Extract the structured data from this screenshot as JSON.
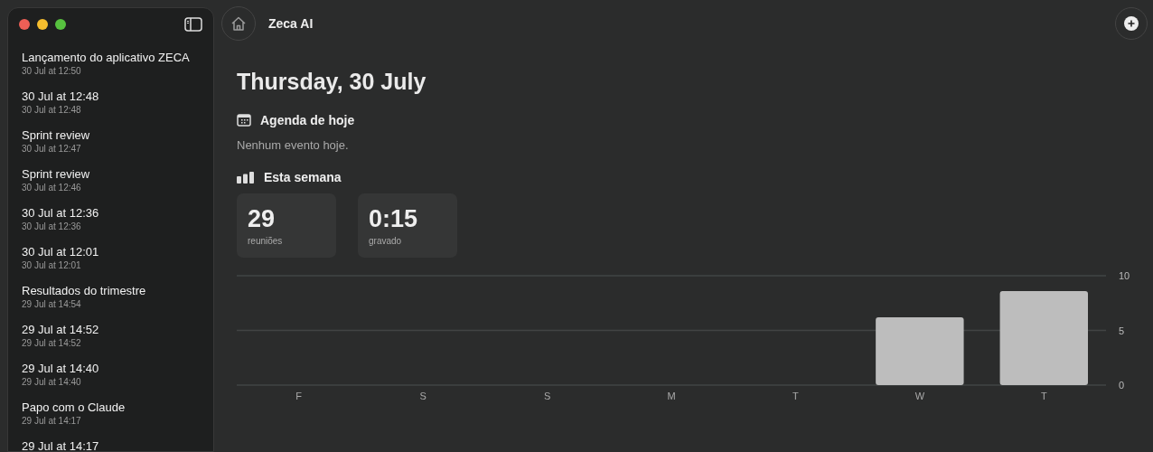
{
  "sidebar": {
    "items": [
      {
        "title": "Lançamento do aplicativo ZECA",
        "time": "30 Jul at 12:50"
      },
      {
        "title": "30 Jul at 12:48",
        "time": "30 Jul at 12:48"
      },
      {
        "title": "Sprint review",
        "time": "30 Jul at 12:47"
      },
      {
        "title": "Sprint review",
        "time": "30 Jul at 12:46"
      },
      {
        "title": "30 Jul at 12:36",
        "time": "30 Jul at 12:36"
      },
      {
        "title": "30 Jul at 12:01",
        "time": "30 Jul at 12:01"
      },
      {
        "title": "Resultados do trimestre",
        "time": "29 Jul at 14:54"
      },
      {
        "title": "29 Jul at 14:52",
        "time": "29 Jul at 14:52"
      },
      {
        "title": "29 Jul at 14:40",
        "time": "29 Jul at 14:40"
      },
      {
        "title": "Papo com o Claude",
        "time": "29 Jul at 14:17"
      },
      {
        "title": "29 Jul at 14:17"
      }
    ]
  },
  "toolbar": {
    "title": "Zeca AI"
  },
  "date_heading": "Thursday, 30 July",
  "agenda": {
    "title": "Agenda de hoje",
    "empty_text": "Nenhum evento hoje."
  },
  "week": {
    "title": "Esta semana",
    "stats": [
      {
        "value": "29",
        "label": "reuniões"
      },
      {
        "value": "0:15",
        "label": "gravado"
      }
    ],
    "chart_data": {
      "type": "bar",
      "categories": [
        "F",
        "S",
        "S",
        "M",
        "T",
        "W",
        "T"
      ],
      "series": [
        {
          "color": "#bdbdbd",
          "values": [
            0,
            0,
            0,
            0,
            0,
            6.2,
            8.6
          ]
        }
      ],
      "ylim": [
        0,
        10
      ],
      "yticks": [
        0,
        5,
        10
      ]
    }
  }
}
